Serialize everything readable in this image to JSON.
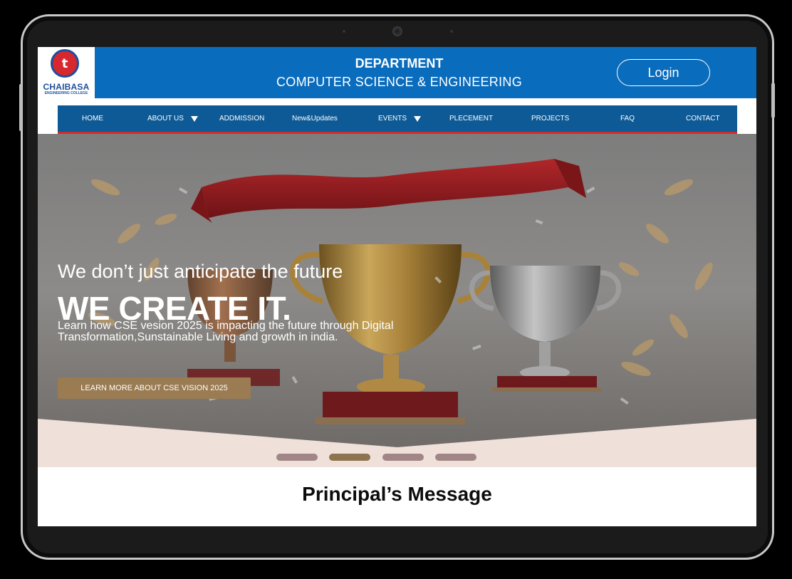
{
  "header": {
    "logo_text": "CHAIBASA",
    "logo_subtext": "ENGINEERING COLLEGE",
    "logo_mark": "t",
    "title": "DEPARTMENT",
    "subtitle": "COMPUTER SCIENCE & ENGINEERING",
    "login_label": "Login"
  },
  "nav": {
    "items": [
      {
        "label": "HOME"
      },
      {
        "label": "ABOUT US"
      },
      {
        "label": "ADDMISSION"
      },
      {
        "label": "New&Updates"
      },
      {
        "label": "EVENTS"
      },
      {
        "label": "PLECEMENT"
      },
      {
        "label": "PROJECTS"
      },
      {
        "label": "FAQ"
      },
      {
        "label": "CONTACT"
      }
    ]
  },
  "hero": {
    "line1": "We don’t just anticipate the future",
    "line2": "WE CREATE IT.",
    "line3": "Learn how CSE vesion 2025 is impacting the future through Digital Transformation,Sunstainable Living and growth in india.",
    "cta_label": "LEARN MORE ABOUT CSE VISION 2025",
    "slides_total": 4,
    "active_slide": 2
  },
  "principal": {
    "title": "Principal’s Message"
  },
  "colors": {
    "header_blue": "#0a6cbd",
    "nav_blue": "#0d5a96",
    "nav_underline": "#d32b2b",
    "cta_brown": "#9a7b52"
  }
}
